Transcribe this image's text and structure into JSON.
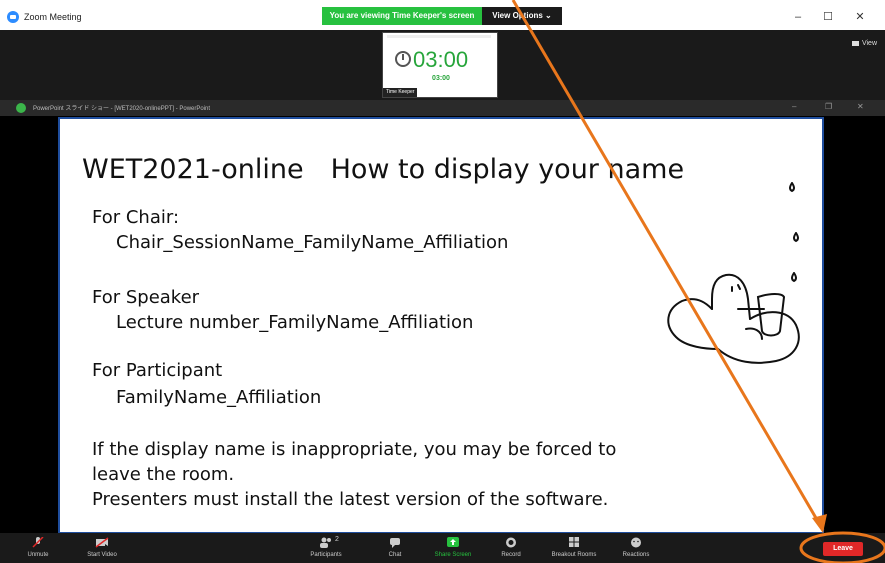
{
  "window": {
    "title": "Zoom Meeting",
    "banner": "You are viewing Time Keeper's screen",
    "view_options": "View Options ⌄",
    "minimize": "–",
    "maximize": "☐",
    "close": "✕"
  },
  "video_strip": {
    "timer_main": "03:00",
    "timer_sub": "03:00",
    "participant_name": "Time Keeper",
    "view_label": "View"
  },
  "powerpoint_bar": {
    "title": "PowerPoint スライド ショー - [WET2020-onlinePPT] - PowerPoint",
    "minimize": "–",
    "restore": "❐",
    "close": "✕"
  },
  "slide": {
    "title": "WET2021-online　How to display your name",
    "chair_label": "For Chair:",
    "chair_format": "Chair_SessionName_FamilyName_Affiliation",
    "speaker_label": "For Speaker",
    "speaker_format": "Lecture number_FamilyName_Affiliation",
    "participant_label": "For Participant",
    "participant_format": "FamilyName_Affiliation",
    "warning_line1": "If the display name is inappropriate, you may be forced to",
    "warning_line2": "leave the room.",
    "note": "Presenters must install the latest version of the software."
  },
  "toolbar": {
    "unmute": "Unmute",
    "start_video": "Start Video",
    "participants": "Participants",
    "participants_count": "2",
    "chat": "Chat",
    "share_screen": "Share Screen",
    "record": "Record",
    "breakout_rooms": "Breakout Rooms",
    "reactions": "Reactions",
    "leave": "Leave"
  },
  "colors": {
    "zoom_blue": "#2D8CFF",
    "banner_green": "#27c13f",
    "timer_green": "#27a53b",
    "slide_border": "#1f4e9e",
    "leave_red": "#e02828",
    "annotation_orange": "#e8761c"
  }
}
